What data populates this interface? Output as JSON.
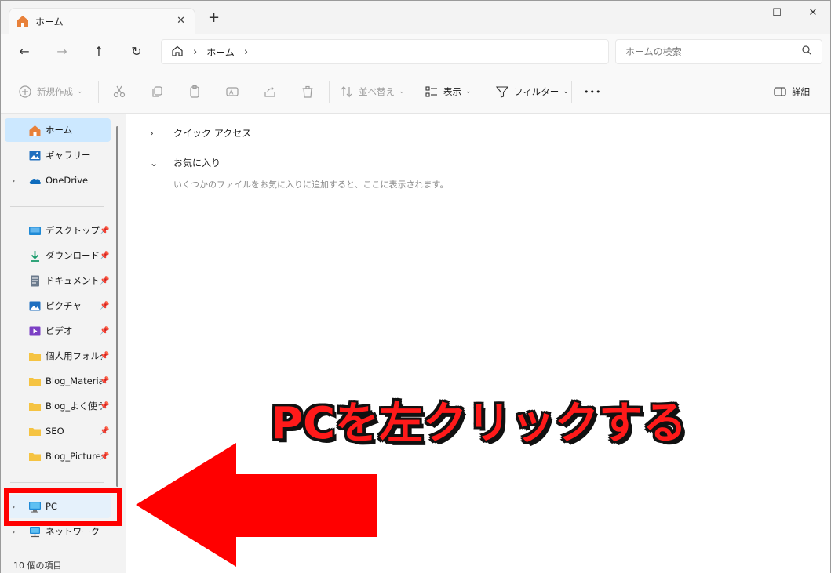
{
  "window": {
    "tab_title": "ホーム",
    "tab_close_glyph": "✕",
    "new_tab_glyph": "+",
    "minimize_glyph": "—",
    "maximize_glyph": "☐",
    "close_glyph": "✕"
  },
  "address_bar": {
    "breadcrumb_sep": "›",
    "breadcrumb_home": "ホーム",
    "breadcrumb_trailing": "›",
    "search_placeholder": "ホームの検索"
  },
  "nav_buttons": {
    "back": "←",
    "forward": "→",
    "up": "↑",
    "refresh": "↻"
  },
  "commands": {
    "new": "新規作成",
    "sort": "並べ替え",
    "view": "表示",
    "filter": "フィルター",
    "more": "•••",
    "details": "詳細",
    "chevron": "⌄"
  },
  "sidebar": {
    "expander": "›",
    "pin_glyph": "📌",
    "top_items": [
      {
        "label": "ホーム",
        "icon": "home-icon"
      },
      {
        "label": "ギャラリー",
        "icon": "gallery-icon"
      },
      {
        "label": "OneDrive",
        "icon": "cloud-icon"
      }
    ],
    "pinned_items": [
      {
        "label": "デスクトップ",
        "icon": "desktop-icon"
      },
      {
        "label": "ダウンロード",
        "icon": "download-icon"
      },
      {
        "label": "ドキュメント",
        "icon": "document-icon"
      },
      {
        "label": "ピクチャ",
        "icon": "pictures-icon"
      },
      {
        "label": "ビデオ",
        "icon": "video-icon"
      },
      {
        "label": "個人用フォルダ",
        "icon": "folder-icon"
      },
      {
        "label": "Blog_Materials",
        "icon": "folder-icon"
      },
      {
        "label": "Blog_よく使う",
        "icon": "folder-icon"
      },
      {
        "label": "SEO",
        "icon": "folder-icon"
      },
      {
        "label": "Blog_Pictures",
        "icon": "folder-icon"
      }
    ],
    "device_items": [
      {
        "label": "PC",
        "icon": "pc-icon"
      },
      {
        "label": "ネットワーク",
        "icon": "network-icon"
      }
    ]
  },
  "status_bar": {
    "item_count": "10 個の項目"
  },
  "content": {
    "quick_access": "クイック アクセス",
    "favorites": "お気に入り",
    "favorites_empty": "いくつかのファイルをお気に入りに追加すると、ここに表示されます。",
    "collapsed_chevron": "›",
    "expanded_chevron": "⌄"
  },
  "annotation": {
    "text": "PCを左クリックする",
    "color": "#ff0000"
  },
  "colors": {
    "selected": "#cce8ff",
    "hovered": "#e5f1fb",
    "home_accent": "#e8813a",
    "onedrive": "#0f6cbd",
    "folder": "#f5c342"
  }
}
